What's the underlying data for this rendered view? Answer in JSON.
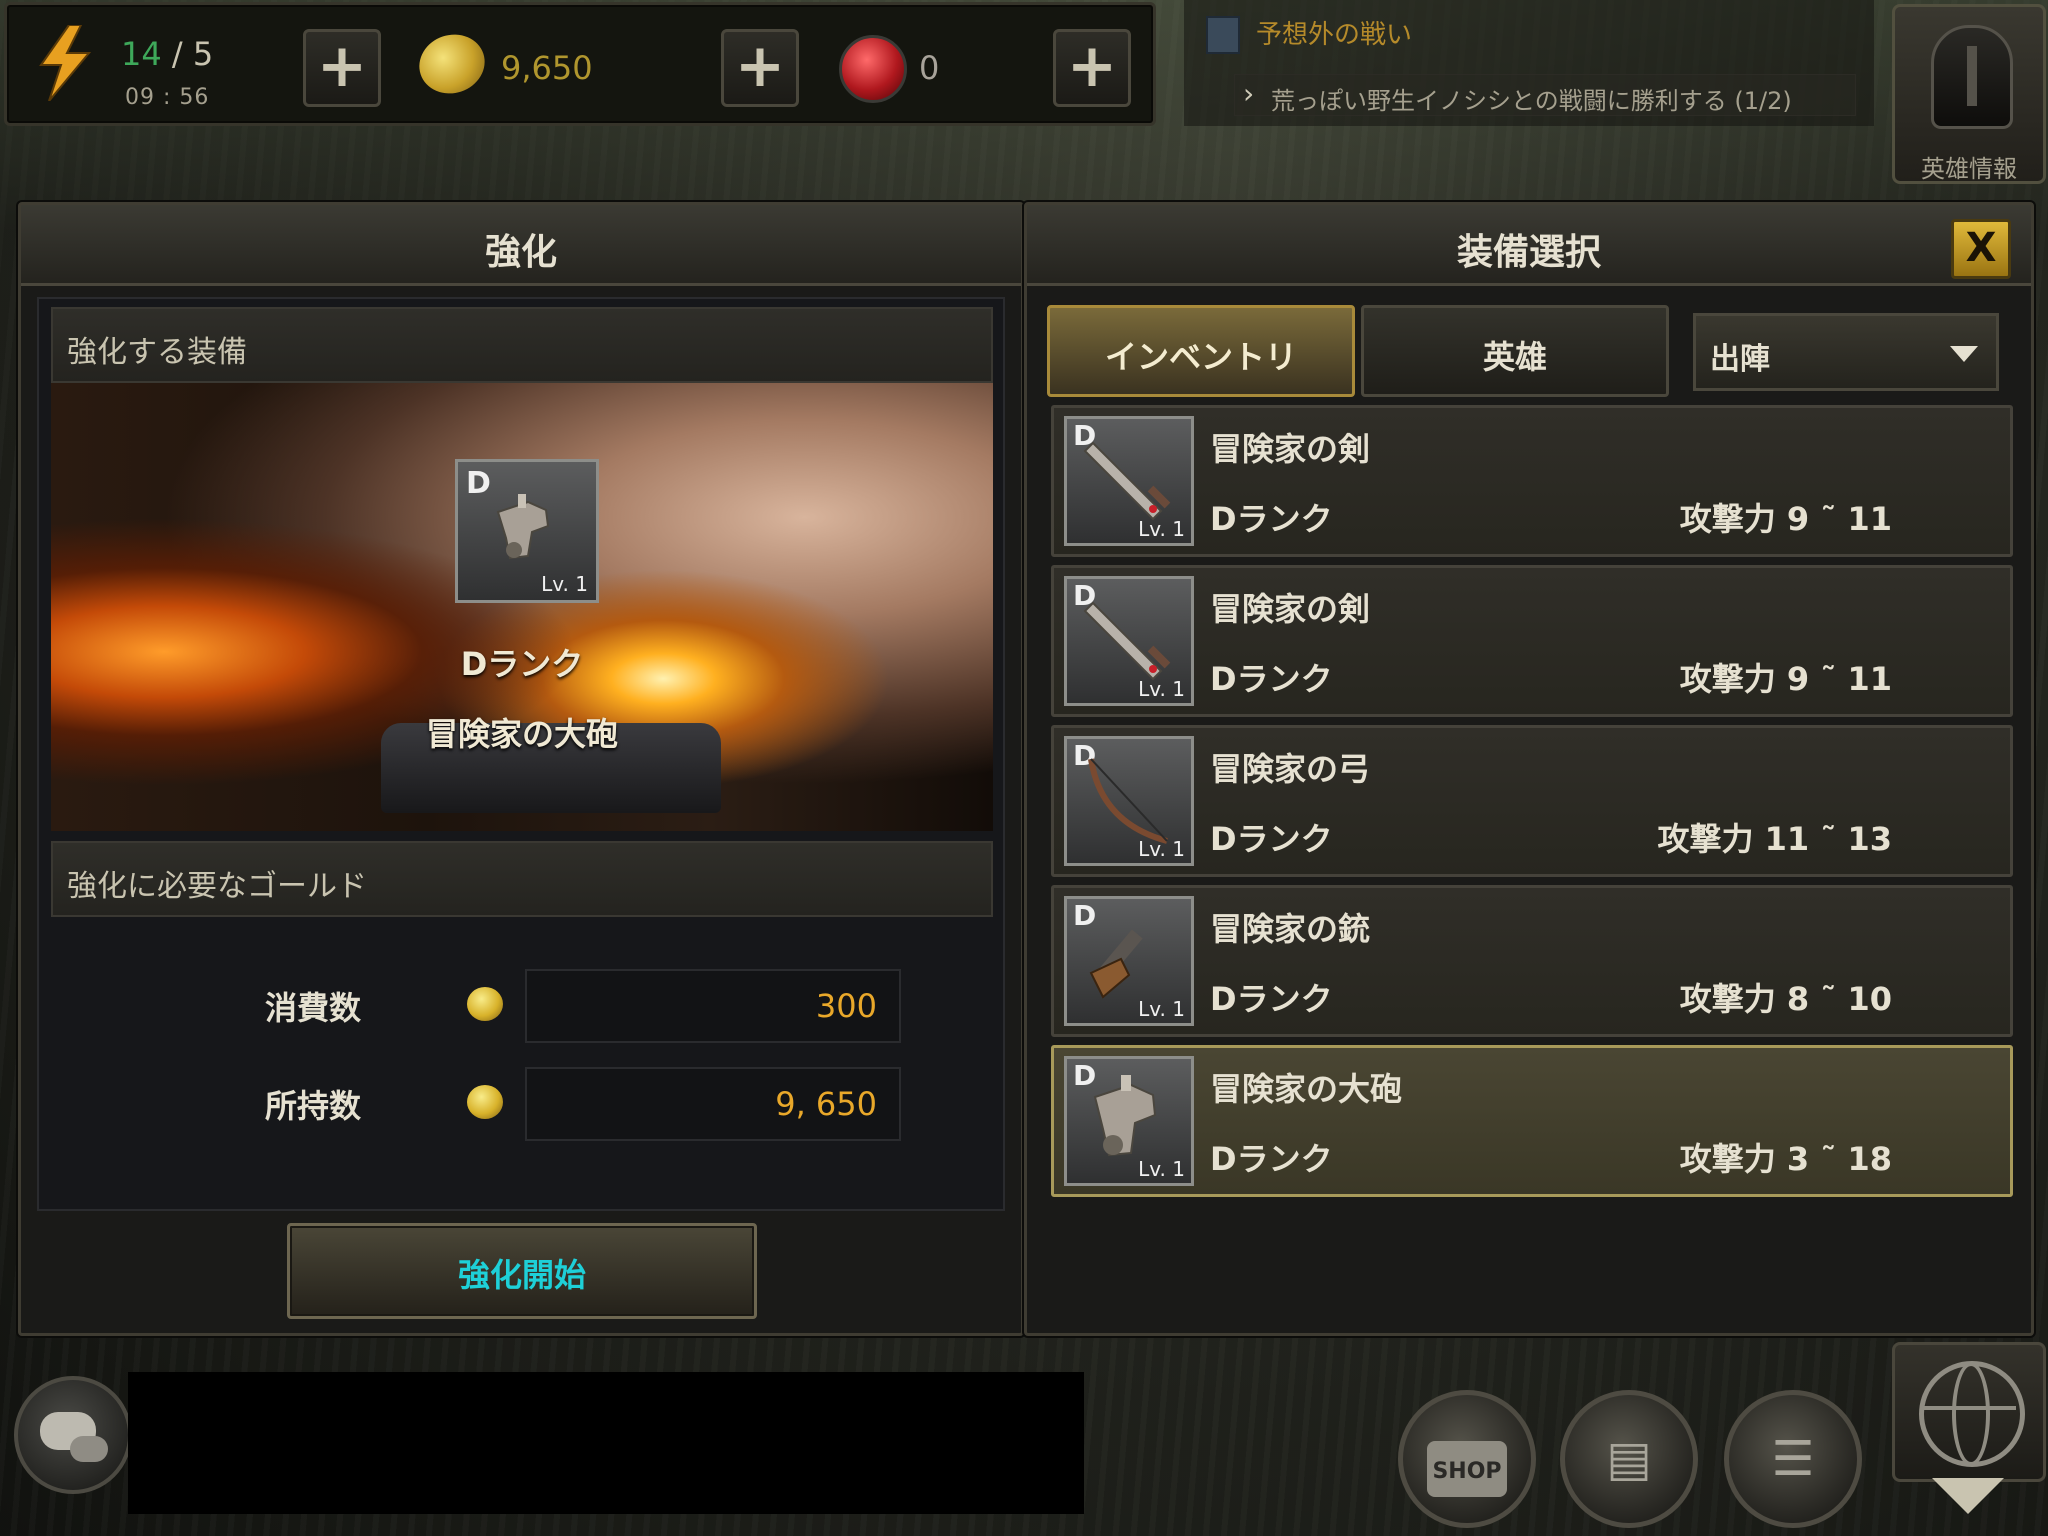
{
  "top_bar": {
    "stamina_current": "14",
    "stamina_sep": " / ",
    "stamina_max": "5",
    "stamina_timer": "09 : 56",
    "gold": "9,650",
    "gems": "0",
    "plus": "+"
  },
  "quest": {
    "title": "予想外の戦い",
    "objective": "荒っぽい野生イノシシとの戦闘に勝利する (1/2)"
  },
  "hero_info": {
    "label": "英雄情報"
  },
  "enhance_panel": {
    "title": "強化",
    "section_equip": "強化する装備",
    "item": {
      "rank_badge": "D",
      "level": "Lv. 1",
      "rank_text": "Dランク",
      "name": "冒険家の大砲"
    },
    "section_gold": "強化に必要なゴールド",
    "cost_label": "消費数",
    "cost_value": "300",
    "owned_label": "所持数",
    "owned_value": "9, 650",
    "start_button": "強化開始"
  },
  "equip_panel": {
    "title": "装備選択",
    "close": "X",
    "tabs": [
      "インベントリ",
      "英雄"
    ],
    "active_tab": "インベントリ",
    "filter_selected": "出陣",
    "items": [
      {
        "badge": "D",
        "level": "Lv. 1",
        "name": "冒険家の剣",
        "rank": "Dランク",
        "attack": "攻撃力 9 ˜ 11",
        "icon": "sword-icon",
        "selected": false
      },
      {
        "badge": "D",
        "level": "Lv. 1",
        "name": "冒険家の剣",
        "rank": "Dランク",
        "attack": "攻撃力 9 ˜ 11",
        "icon": "sword-icon",
        "selected": false
      },
      {
        "badge": "D",
        "level": "Lv. 1",
        "name": "冒険家の弓",
        "rank": "Dランク",
        "attack": "攻撃力 11 ˜ 13",
        "icon": "bow-icon",
        "selected": false
      },
      {
        "badge": "D",
        "level": "Lv. 1",
        "name": "冒険家の銃",
        "rank": "Dランク",
        "attack": "攻撃力 8 ˜ 10",
        "icon": "pistol-icon",
        "selected": false
      },
      {
        "badge": "D",
        "level": "Lv. 1",
        "name": "冒険家の大砲",
        "rank": "Dランク",
        "attack": "攻撃力 3 ˜ 18",
        "icon": "cannon-icon",
        "selected": true
      }
    ]
  },
  "bottom_bar": {
    "shop_label": "SHOP"
  },
  "colors": {
    "accent_gold": "#e9a82a",
    "start_text": "#1ed0d8",
    "stamina_green": "#3ea85a"
  }
}
